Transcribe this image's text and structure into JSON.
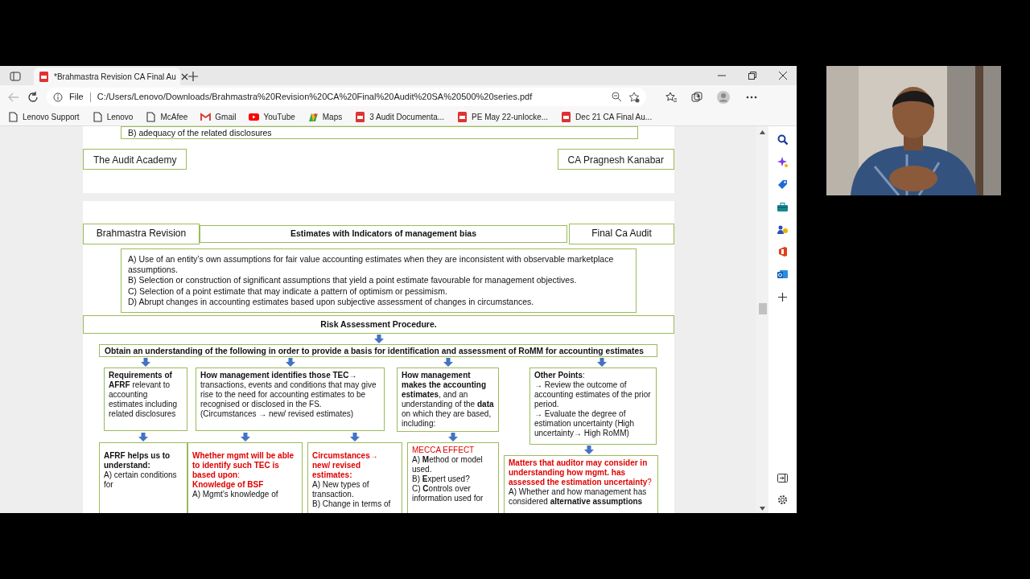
{
  "browser": {
    "tabs": [
      {
        "title": "*Brahmastra Revision CA Final Au",
        "selected": true
      }
    ],
    "address": {
      "scheme": "File",
      "url": "C:/Users/Lenovo/Downloads/Brahmastra%20Revision%20CA%20Final%20Audit%20SA%20500%20series.pdf"
    },
    "bookmarks": [
      {
        "label": "Lenovo Support",
        "kind": "page"
      },
      {
        "label": "Lenovo",
        "kind": "page"
      },
      {
        "label": "McAfee",
        "kind": "page"
      },
      {
        "label": "Gmail",
        "kind": "mail"
      },
      {
        "label": "YouTube",
        "kind": "video"
      },
      {
        "label": "Maps",
        "kind": "map"
      },
      {
        "label": "3 Audit Documenta...",
        "kind": "pdf"
      },
      {
        "label": "PE May 22-unlocke...",
        "kind": "pdf"
      },
      {
        "label": "Dec 21 CA Final Au...",
        "kind": "pdf"
      }
    ]
  },
  "page_1": {
    "last_item": "B) adequacy of the related disclosures",
    "footer_left": "The Audit Academy",
    "footer_right": "CA Pragnesh Kanabar"
  },
  "page_2": {
    "header_left": "Brahmastra Revision",
    "header_title": "Estimates with Indicators of management bias",
    "header_right": "Final Ca Audit",
    "indicators": [
      "A) Use of an entity’s own assumptions for fair value accounting estimates when they are inconsistent with observable marketplace assumptions.",
      "B) Selection or construction of significant assumptions that yield a point estimate favourable for management objectives.",
      "C) Selection of a point estimate that may indicate a pattern of optimism or pessimism.",
      "D) Abrupt changes in accounting estimates based upon subjective assessment of changes in circumstances."
    ],
    "procedure": "Risk Assessment Procedure.",
    "obtain": "Obtain an understanding of the following in order to provide a basis for identification and assessment of RoMM for accounting estimates",
    "understanding_boxes": [
      {
        "paragraphs": [
          {
            "kind": "body",
            "text": "**Requirements of AFRF** relevant to accounting estimates including related disclosures"
          }
        ]
      },
      {
        "paragraphs": [
          {
            "kind": "body",
            "text": "**How management identifies those TEC→** transactions, events and conditions that may give rise to the need for accounting estimates to be recognised or disclosed in the FS."
          },
          {
            "kind": "body",
            "text": "(Circumstances → new/ revised estimates)"
          }
        ]
      },
      {
        "paragraphs": [
          {
            "kind": "body",
            "text": "**How management makes the accounting estimates**, and an understanding of the **data** on which they are based, including:"
          }
        ]
      },
      {
        "paragraphs": [
          {
            "kind": "body",
            "text": "**Other Points**:"
          },
          {
            "kind": "body",
            "text": "→ Review the outcome of accounting estimates of the prior period."
          },
          {
            "kind": "body",
            "text": "→ Evaluate the degree of estimation uncertainty (High uncertainty→ High RoMM)"
          }
        ]
      }
    ],
    "detail_boxes": [
      {
        "paragraphs": [
          {
            "kind": "body",
            "text": "**AFRF helps us to understand:**"
          },
          {
            "kind": "body",
            "text": "A) certain conditions for"
          }
        ]
      },
      {
        "paragraphs": [
          {
            "kind": "highlight",
            "text": "**Whether mgmt will be able to identify such TEC is based upon**:"
          },
          {
            "kind": "highlight",
            "text": "**Knowledge of BSF**"
          },
          {
            "kind": "body",
            "text": "A) Mgmt’s knowledge of"
          }
        ]
      },
      {
        "paragraphs": [
          {
            "kind": "highlight",
            "text": "**Circumstances→ new/ revised estimates:**"
          },
          {
            "kind": "body",
            "text": "A) New types of transaction."
          },
          {
            "kind": "body",
            "text": "B) Change in terms of"
          }
        ]
      },
      {
        "paragraphs": [
          {
            "kind": "highlight",
            "text": "MECCA EFFECT"
          },
          {
            "kind": "body",
            "text": "A) **M**ethod or model used."
          },
          {
            "kind": "body",
            "text": "B) **E**xpert used?"
          },
          {
            "kind": "body",
            "text": "C) **C**ontrols over information used for"
          }
        ]
      },
      {
        "paragraphs": [
          {
            "kind": "highlight",
            "text": "**Matters that auditor may consider in understanding how mgmt. has assessed the estimation uncertainty**?"
          },
          {
            "kind": "body",
            "text": "A) Whether and how management has considered **alternative assumptions**"
          }
        ]
      }
    ]
  }
}
